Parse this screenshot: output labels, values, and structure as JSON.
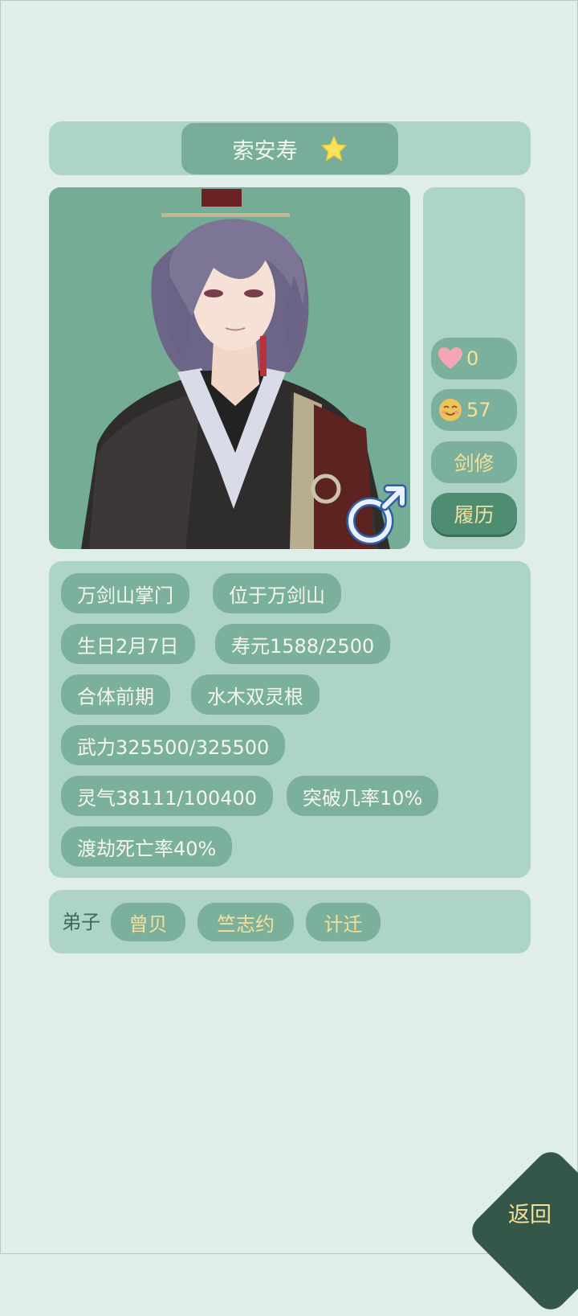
{
  "character": {
    "name": "索安寿",
    "gender_symbol": "♂"
  },
  "stats": {
    "heart_value": "0",
    "mood_value": "57",
    "class_label": "剑修",
    "history_button": "履历"
  },
  "info_tags": [
    "万剑山掌门",
    "位于万剑山",
    "生日2月7日",
    "寿元1588/2500",
    "合体前期",
    "水木双灵根",
    "武力325500/325500",
    "灵气38111/100400",
    "突破几率10%",
    "渡劫死亡率40%"
  ],
  "disciples": {
    "label": "弟子",
    "names": [
      "曾贝",
      "竺志约",
      "计迁"
    ]
  },
  "back_button": "返回",
  "colors": {
    "background": "#dfeee9",
    "panel": "#aed3c7",
    "pill": "#7bb09d",
    "accent_text": "#f4e09a",
    "back": "#34574a"
  },
  "icons": [
    "star-icon",
    "heart-icon",
    "mood-face-icon",
    "male-symbol-icon"
  ]
}
